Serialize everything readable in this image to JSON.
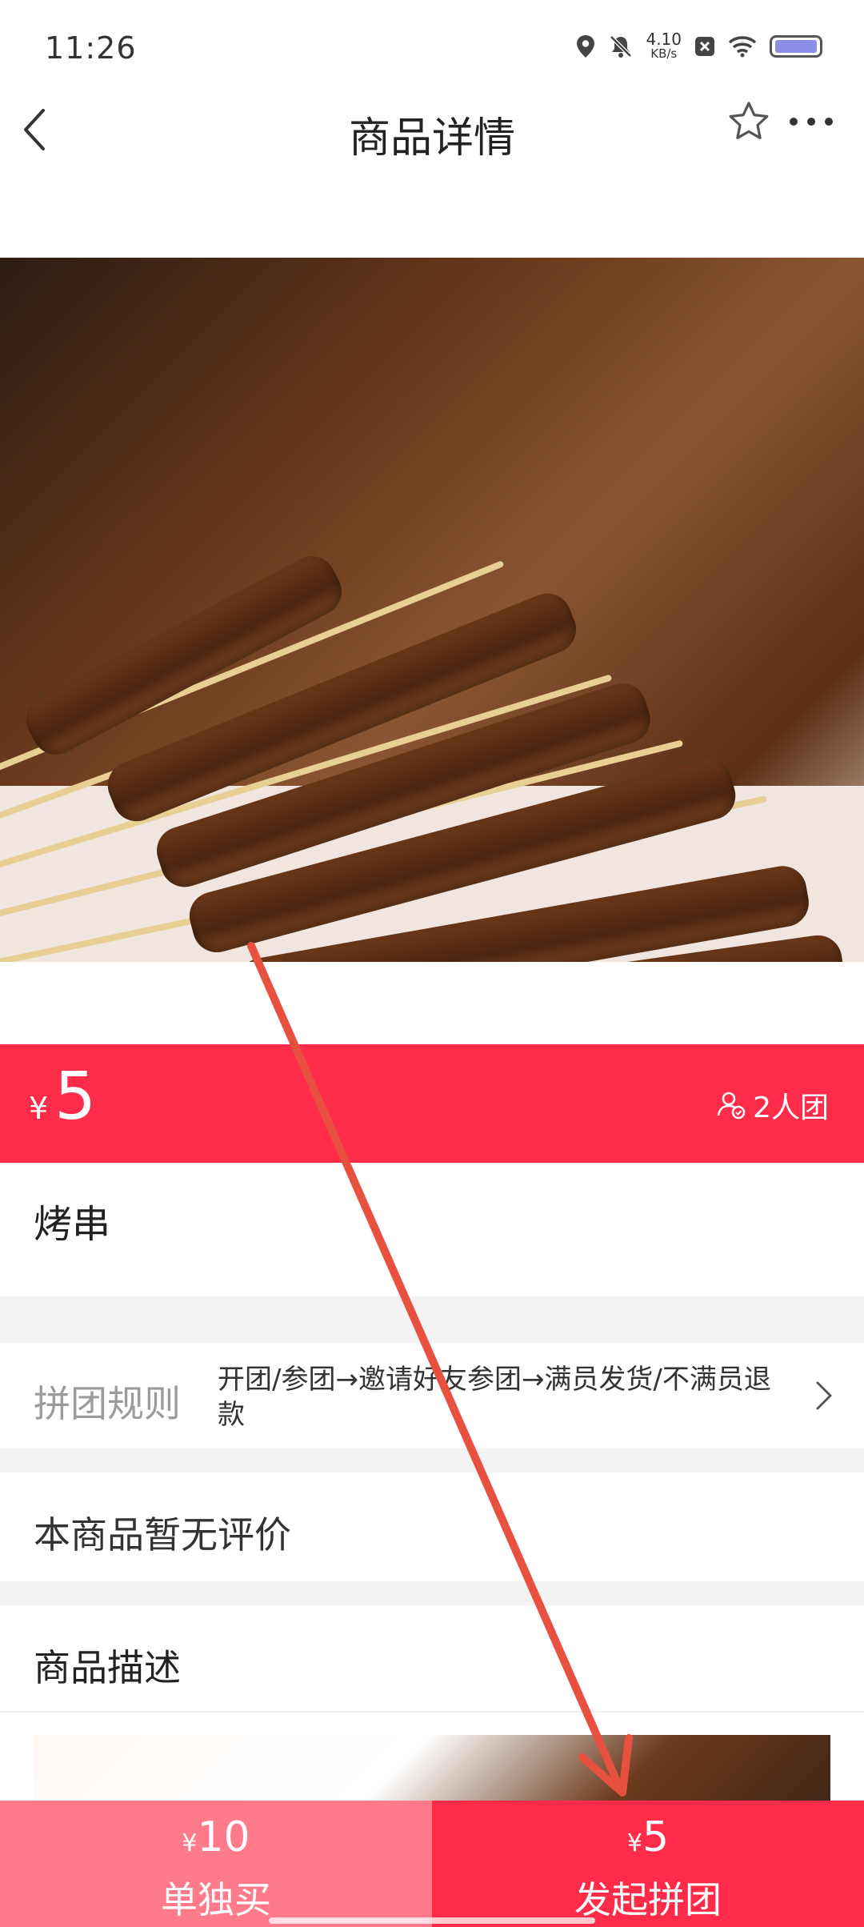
{
  "status_bar": {
    "time": "11:26",
    "net_speed_value": "4.10",
    "net_speed_unit": "KB/s"
  },
  "header": {
    "title": "商品详情"
  },
  "price_band": {
    "currency": "¥",
    "price": "5",
    "group_label": "2人团"
  },
  "product": {
    "name": "烤串"
  },
  "rules": {
    "label": "拼团规则",
    "text": "开团/参团→邀请好友参团→满员发货/不满员退款"
  },
  "reviews": {
    "text": "本商品暂无评价"
  },
  "description": {
    "title": "商品描述"
  },
  "bottom_bar": {
    "single": {
      "currency": "¥",
      "price": "10",
      "label": "单独买"
    },
    "group": {
      "currency": "¥",
      "price": "5",
      "label": "发起拼团"
    }
  },
  "colors": {
    "accent": "#fe2c48",
    "single_button": "#ff7a8a",
    "annotation_arrow": "#e8503f"
  },
  "icons": [
    "back-arrow-icon",
    "star-outline-icon",
    "more-dots-icon",
    "location-icon",
    "bell-off-icon",
    "wifi-icon",
    "battery-icon",
    "group-people-icon",
    "chevron-right-icon"
  ]
}
